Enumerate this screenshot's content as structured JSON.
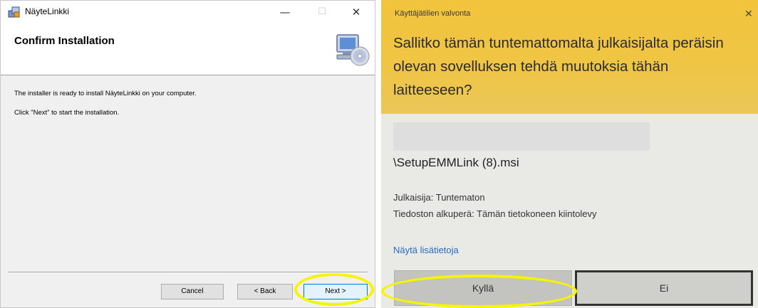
{
  "installer": {
    "window_title": "NäyteLinkki",
    "window_buttons": {
      "minimize": "—",
      "maximize": "☐",
      "close": "✕"
    },
    "page_title": "Confirm Installation",
    "line1": "The installer is ready to install NäyteLinkki on your computer.",
    "line2": "Click \"Next\" to start the installation.",
    "buttons": {
      "cancel": "Cancel",
      "back": "< Back",
      "next": "Next >"
    },
    "icons": [
      "installer-app-icon",
      "computer-cd-icon"
    ]
  },
  "uac": {
    "caption": "Käyttäjätilien valvonta",
    "close": "✕",
    "question": "Sallitko tämän tuntemattomalta julkaisijalta peräisin olevan sovelluksen tehdä muutoksia tähän laitteeseen?",
    "filename": "\\SetupEMMLink (8).msi",
    "publisher": "Julkaisija: Tuntematon",
    "origin": "Tiedoston alkuperä: Tämän tietokoneen kiintolevy",
    "more_info": "Näytä lisätietoja",
    "buttons": {
      "yes": "Kyllä",
      "no": "Ei"
    }
  },
  "colors": {
    "uac_header": "#f2c43d",
    "highlight": "#f5f500",
    "link": "#2a6cc0",
    "focus": "#0078d7"
  }
}
